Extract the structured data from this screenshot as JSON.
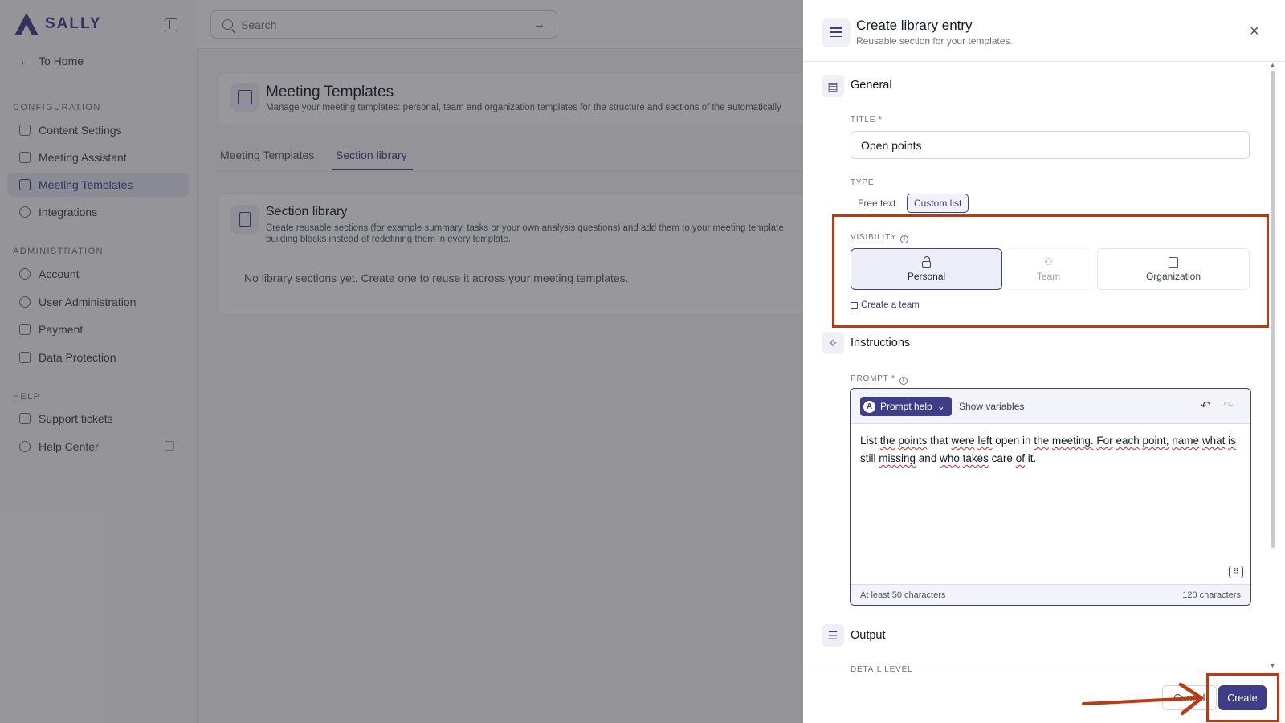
{
  "app": {
    "logo_text": "SALLY",
    "search_placeholder": "Search",
    "to_home": "To Home",
    "nav": {
      "configuration_title": "CONFIGURATION",
      "configuration_items": [
        "Content Settings",
        "Meeting Assistant",
        "Meeting Templates",
        "Integrations"
      ],
      "active_item": "Meeting Templates",
      "administration_title": "ADMINISTRATION",
      "administration_items": [
        "Account",
        "User Administration",
        "Payment",
        "Data Protection"
      ],
      "help_title": "HELP",
      "help_items": [
        "Support tickets",
        "Help Center"
      ]
    },
    "page": {
      "title": "Meeting Templates",
      "subtitle": "Manage your meeting templates: personal, team and organization templates for the structure and sections of the automatically",
      "tabs": [
        "Meeting Templates",
        "Section library"
      ],
      "active_tab": "Section library",
      "library": {
        "title": "Section library",
        "subtitle": "Create reusable sections (for example summary, tasks or your own analysis questions) and add them to your meeting template building blocks instead of redefining them in every template.",
        "empty": "No library sections yet. Create one to reuse it across your meeting templates."
      }
    }
  },
  "drawer": {
    "title": "Create library entry",
    "subtitle": "Reusable section for your templates.",
    "close_icon": "×",
    "general": {
      "section_title": "General",
      "title_label": "TITLE *",
      "title_value": "Open points",
      "type_label": "TYPE",
      "type_options": [
        "Free text",
        "Custom list"
      ],
      "type_selected": "Custom list",
      "visibility_label": "VISIBILITY",
      "visibility_options": [
        "Personal",
        "Team",
        "Organization"
      ],
      "visibility_selected": "Personal",
      "create_team_link": "Create a team"
    },
    "instructions": {
      "section_title": "Instructions",
      "prompt_label": "PROMPT *",
      "prompt_help": "Prompt help",
      "show_variables": "Show variables",
      "prompt_text": "List the points that were left open in the meeting. For each point, name what is still missing and who takes care of it.",
      "min_chars": "At least 50 characters",
      "char_count": "120 characters"
    },
    "output": {
      "section_title": "Output",
      "detail_level_label": "DETAIL LEVEL"
    },
    "footer": {
      "cancel": "Cancel",
      "create": "Create"
    }
  },
  "annotation_color": "#bc3a12",
  "accent_color": "#3f3d87"
}
